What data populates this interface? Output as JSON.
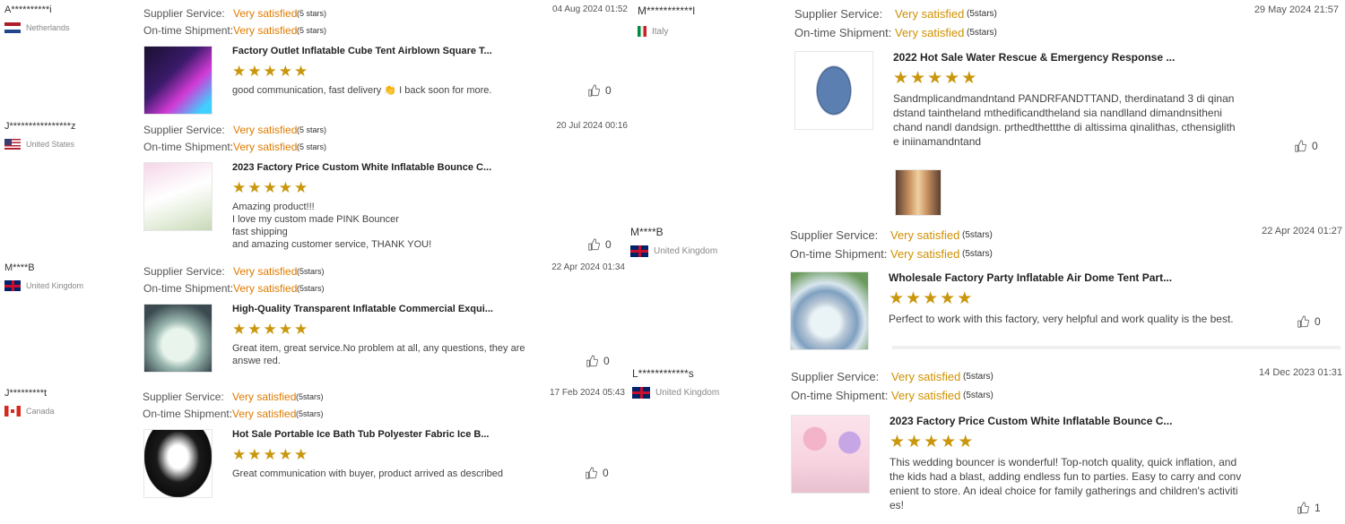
{
  "labels": {
    "supplier_service": "Supplier Service:",
    "on_time_shipment": "On-time Shipment:",
    "very_satisfied": "Very satisfied",
    "stars_note_a": "(5 stars)",
    "stars_note_b": "(5stars)"
  },
  "colors": {
    "rating_text": "#e07b00",
    "star": "#c9960c"
  },
  "reviews": [
    {
      "reviewer": "A**********i",
      "country": "Netherlands",
      "date": "04 Aug 2024 01:52",
      "product_title": "Factory Outlet Inflatable Cube Tent Airblown Square T...",
      "text": "good communication,  fast delivery 👏  I back soon for more.",
      "likes": "0",
      "icon": "thumbs-up-icon"
    },
    {
      "reviewer": "J****************z",
      "country": "United States",
      "date": "20 Jul 2024 00:16",
      "product_title": "2023 Factory Price Custom White Inflatable Bounce C...",
      "text_lines": [
        "Amazing product!!!",
        "I love my custom made PINK Bouncer",
        "fast shipping",
        "and amazing customer service,  THANK YOU!"
      ],
      "likes": "0"
    },
    {
      "reviewer": "M****B",
      "country": "United Kingdom",
      "date": "22 Apr 2024 01:34",
      "product_title": "High-Quality Transparent Inflatable Commercial Exqui...",
      "text": "Great item, great service.No problem at all, any questions, they are answe red.",
      "likes": "0"
    },
    {
      "reviewer": "J*********t",
      "country": "Canada",
      "date": "17 Feb 2024 05:43",
      "product_title": "Hot Sale Portable Ice Bath Tub Polyester Fabric Ice B...",
      "text": "Great communication with buyer, product arrived as described",
      "likes": "0"
    },
    {
      "reviewer": "M***********l",
      "country": "Italy",
      "date": "29 May 2024 21:57",
      "product_title": "2022 Hot Sale Water Rescue & Emergency Response ...",
      "text": "Sandmplicandmandntand PANDRFANDTTAND, therdinatand 3 di qinan dstand taintheland mthedificandtheland sia nandlland dimandnsitheni chand nandl dandsign. prthedthettthe di altissima qinalithas, cthensiglith e iniinamandntand",
      "likes": "0"
    },
    {
      "reviewer": "M****B",
      "country": "United Kingdom",
      "date": "22 Apr 2024 01:27",
      "product_title": "Wholesale Factory Party Inflatable Air Dome Tent Part...",
      "text": "Perfect to work with this factory, very helpful and work quality is the best.",
      "likes": "0"
    },
    {
      "reviewer": "L************s",
      "country": "United Kingdom",
      "date": "14 Dec 2023 01:31",
      "product_title": "2023 Factory Price Custom White Inflatable Bounce C...",
      "text": "This wedding bouncer is wonderful! Top-notch quality, quick inflation, and the kids had a blast, adding endless fun to parties. Easy to carry and conv enient to store. An ideal choice for family gatherings and children's activiti es!",
      "likes": "1"
    }
  ]
}
